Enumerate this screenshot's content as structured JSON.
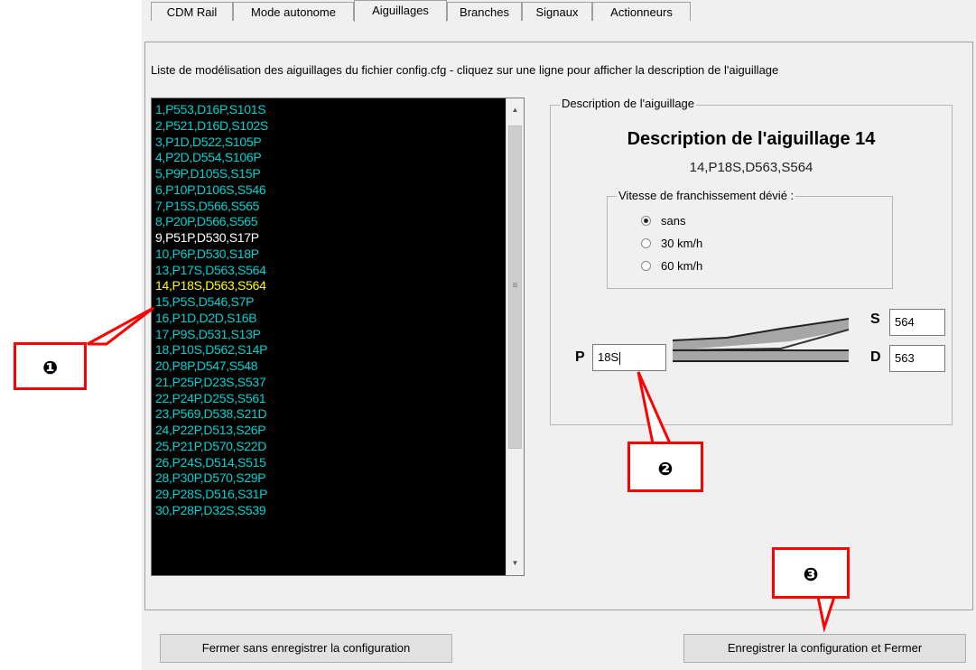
{
  "tabs": [
    "CDM Rail",
    "Mode autonome",
    "Aiguillages",
    "Branches",
    "Signaux",
    "Actionneurs"
  ],
  "active_tab": "Aiguillages",
  "caption": "Liste de modélisation des aiguillages du fichier config.cfg - cliquez sur une ligne pour afficher la description de l'aiguillage",
  "list": {
    "items": [
      {
        "text": "1,P553,D16P,S101S",
        "color": "#00d2d2"
      },
      {
        "text": "2,P521,D16D,S102S",
        "color": "#00d2d2"
      },
      {
        "text": "3,P1D,D522,S105P",
        "color": "#00d2d2"
      },
      {
        "text": "4,P2D,D554,S106P",
        "color": "#00d2d2"
      },
      {
        "text": "5,P9P,D105S,S15P",
        "color": "#00d2d2"
      },
      {
        "text": "6,P10P,D106S,S546",
        "color": "#00d2d2"
      },
      {
        "text": "7,P15S,D566,S565",
        "color": "#00d2d2"
      },
      {
        "text": "8,P20P,D566,S565",
        "color": "#00d2d2"
      },
      {
        "text": "9,P51P,D530,S17P",
        "color": "#ffffff"
      },
      {
        "text": "10,P6P,D530,S18P",
        "color": "#00d2d2"
      },
      {
        "text": "13,P17S,D563,S564",
        "color": "#00d2d2"
      },
      {
        "text": "14,P18S,D563,S564",
        "color": "#ffff00"
      },
      {
        "text": "15,P5S,D546,S7P",
        "color": "#00d2d2"
      },
      {
        "text": "16,P1D,D2D,S16B",
        "color": "#00d2d2"
      },
      {
        "text": "17,P9S,D531,S13P",
        "color": "#00d2d2"
      },
      {
        "text": "18,P10S,D562,S14P",
        "color": "#00d2d2"
      },
      {
        "text": "20,P8P,D547,S548",
        "color": "#00d2d2"
      },
      {
        "text": "21,P25P,D23S,S537",
        "color": "#00d2d2"
      },
      {
        "text": "22,P24P,D25S,S561",
        "color": "#00d2d2"
      },
      {
        "text": "23,P569,D538,S21D",
        "color": "#00d2d2"
      },
      {
        "text": "24,P22P,D513,S26P",
        "color": "#00d2d2"
      },
      {
        "text": "25,P21P,D570,S22D",
        "color": "#00d2d2"
      },
      {
        "text": "26,P24S,D514,S515",
        "color": "#00d2d2"
      },
      {
        "text": "28,P30P,D570,S29P",
        "color": "#00d2d2"
      },
      {
        "text": "29,P28S,D516,S31P",
        "color": "#00d2d2"
      },
      {
        "text": "30,P28P,D32S,S539",
        "color": "#00d2d2"
      }
    ]
  },
  "description": {
    "group_label": "Description de l'aiguillage",
    "title": "Description de l'aiguillage 14",
    "subtitle": "14,P18S,D563,S564",
    "speed_label": "Vitesse de franchissement dévié :",
    "speed_options": [
      "sans",
      "30 km/h",
      "60 km/h"
    ],
    "speed_selected": "sans",
    "p_label": "P",
    "p_value": "18S",
    "s_label": "S",
    "s_value": "564",
    "d_label": "D",
    "d_value": "563"
  },
  "buttons": {
    "close_no_save": "Fermer sans enregistrer la configuration",
    "save_close": "Enregistrer la configuration et Fermer"
  },
  "callouts": [
    "❶",
    "❷",
    "❸"
  ],
  "colors": {
    "callout_border": "#ff0000",
    "list_background": "#000000",
    "list_text": "#00d2d2",
    "list_selected_text": "#ffff00"
  }
}
